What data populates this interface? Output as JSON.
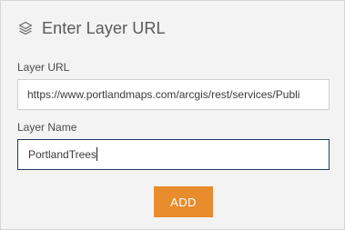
{
  "header": {
    "icon": "layers-icon",
    "title": "Enter Layer URL"
  },
  "layer_url": {
    "label": "Layer URL",
    "value": "https://www.portlandmaps.com/arcgis/rest/services/Publi"
  },
  "layer_name": {
    "label": "Layer Name",
    "value": "PortlandTrees"
  },
  "actions": {
    "add_label": "ADD"
  },
  "colors": {
    "accent": "#e88c2d",
    "panel_bg": "#f3f3f3",
    "focus_border": "#1f3b66"
  }
}
